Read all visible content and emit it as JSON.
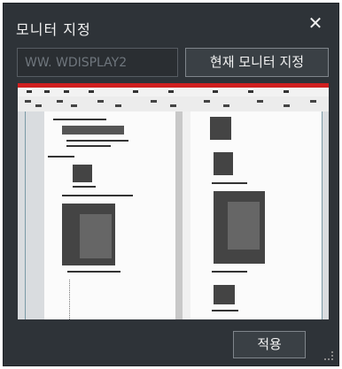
{
  "dialog": {
    "title": "모니터 지정",
    "close_icon": "close-icon",
    "display_input": {
      "value": "WW. WDISPLAY2",
      "placeholder": ""
    },
    "current_monitor_button": "현재 모니터 지정",
    "apply_button": "적용"
  }
}
